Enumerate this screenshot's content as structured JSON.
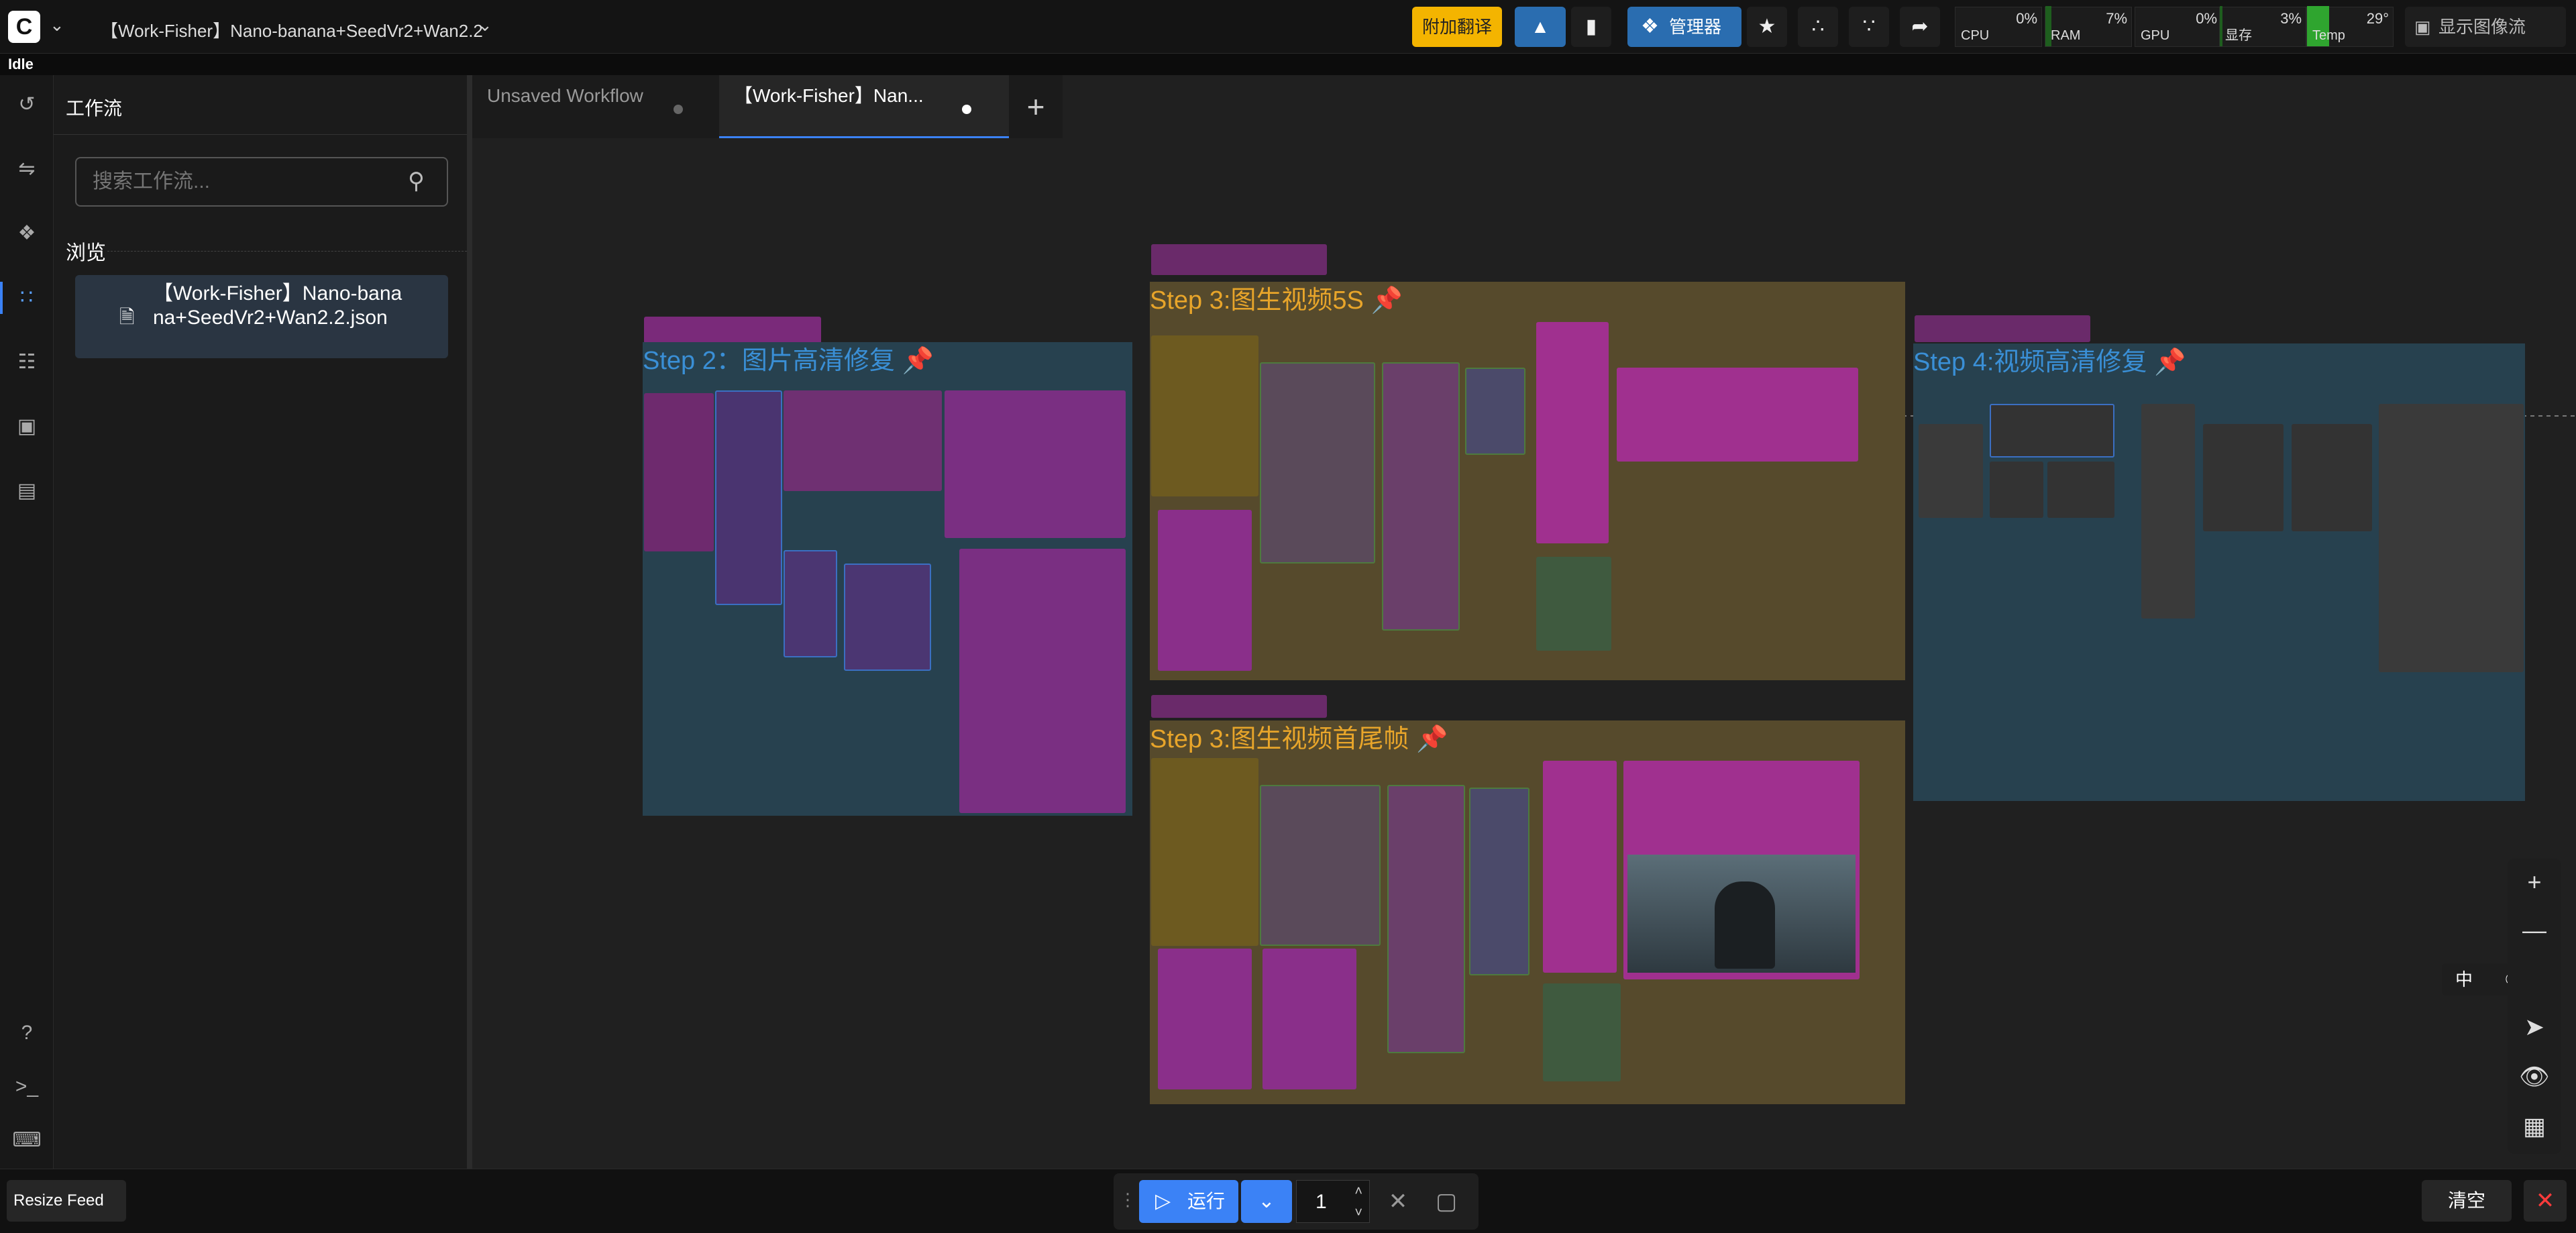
{
  "topbar": {
    "logo": "C",
    "workflow_title": "【Work-Fisher】Nano-banana+SeedVr2+Wan2.2",
    "translate_button": "附加翻译",
    "manager_button": "管理器",
    "show_image_flow": "显示图像流",
    "stats": [
      {
        "label": "CPU",
        "value": "0%"
      },
      {
        "label": "RAM",
        "value": "7%"
      },
      {
        "label": "GPU",
        "value": "0%"
      },
      {
        "label": "显存",
        "value": "3%"
      },
      {
        "label": "Temp",
        "value": "29°"
      }
    ]
  },
  "status": "Idle",
  "sidebar": {
    "panel_title": "工作流",
    "search_placeholder": "搜索工作流...",
    "browse_label": "浏览",
    "files": [
      {
        "name": "【Work-Fisher】Nano-banana+SeedVr2+Wan2.2.json"
      }
    ]
  },
  "tabs": [
    {
      "label": "Unsaved Workflow"
    },
    {
      "label": "【Work-Fisher】Nan..."
    }
  ],
  "groups": {
    "step2": "Step 2：图片高清修复",
    "step3a": "Step 3:图生视频5S",
    "step3b": "Step 3:图生视频首尾帧",
    "step4": "Step 4:视频高清修复"
  },
  "ime": {
    "label": "中"
  },
  "bottom": {
    "resize_feed": "Resize Feed",
    "run_label": "运行",
    "queue_count": "1",
    "clear_label": "清空"
  },
  "colors": {
    "accent": "#3b82f6",
    "group_blue": "#2b4a5e",
    "group_gold": "#5e5130",
    "node_magenta": "#8a2f8a",
    "node_green": "#3f5a3f",
    "warn_yellow": "#f4b400"
  }
}
